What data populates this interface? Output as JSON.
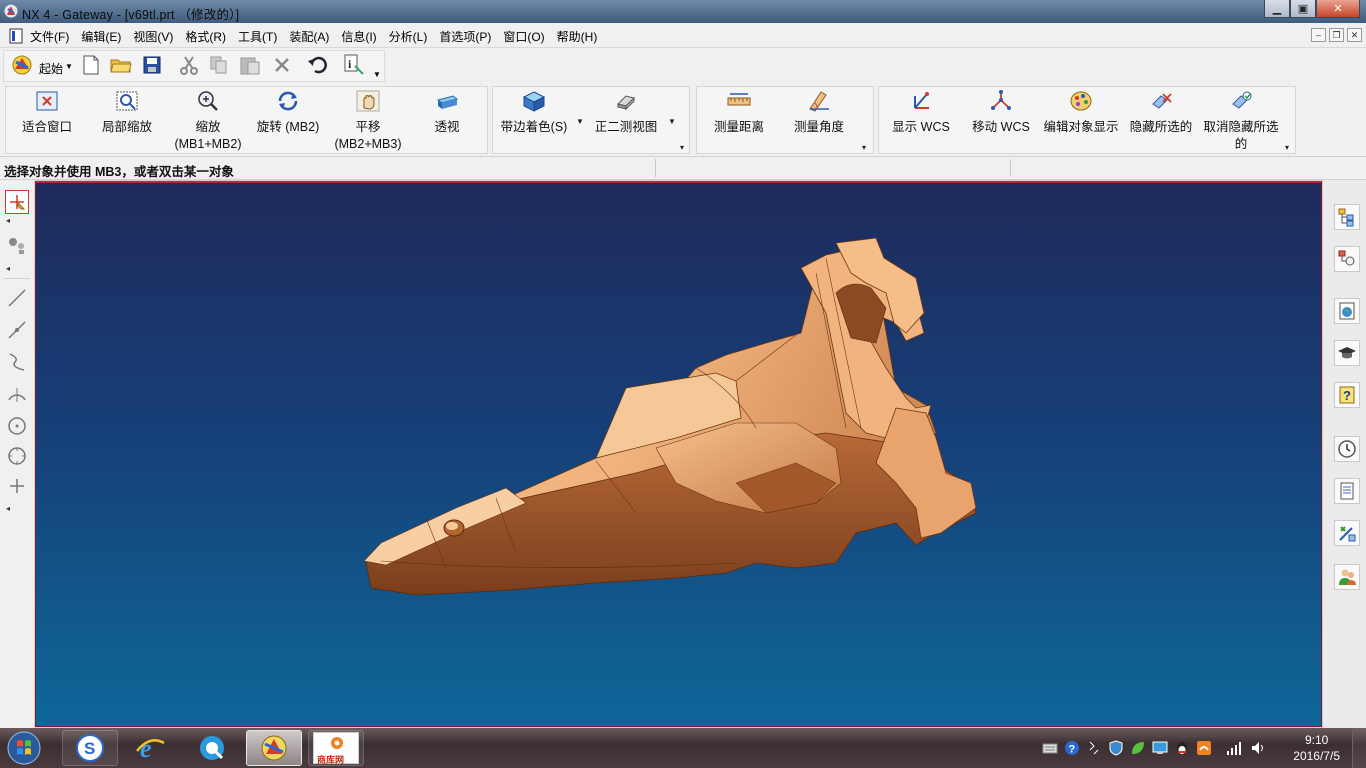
{
  "window": {
    "title": "NX 4 - Gateway - [v69tl.prt （修改的）]",
    "controls": [
      "minimize",
      "maximize",
      "close"
    ]
  },
  "menubar": {
    "items": [
      "文件(F)",
      "编辑(E)",
      "视图(V)",
      "格式(R)",
      "工具(T)",
      "装配(A)",
      "信息(I)",
      "分析(L)",
      "首选项(P)",
      "窗口(O)",
      "帮助(H)"
    ]
  },
  "standard_toolbar": {
    "start_label": "起始",
    "icons": [
      "new-icon",
      "open-icon",
      "save-icon",
      "cut-icon",
      "copy-icon",
      "paste-icon",
      "delete-icon",
      "undo-icon",
      "info-icon"
    ]
  },
  "view_toolbar": {
    "buttons": [
      {
        "label": "适合窗口",
        "icon": "fit-icon"
      },
      {
        "label": "局部缩放",
        "icon": "zoom-region-icon"
      },
      {
        "label": "缩放",
        "label2": "(MB1+MB2)",
        "icon": "zoom-icon"
      },
      {
        "label": "旋转 (MB2)",
        "icon": "rotate-icon"
      },
      {
        "label": "平移",
        "label2": "(MB2+MB3)",
        "icon": "pan-icon"
      },
      {
        "label": "透视",
        "icon": "perspective-icon"
      },
      {
        "label": "带边着色(S)",
        "icon": "shaded-edges-icon"
      },
      {
        "label": "正二测视图",
        "icon": "dimetric-icon"
      }
    ]
  },
  "analysis_toolbar": {
    "buttons": [
      {
        "label": "测量距离",
        "icon": "measure-distance-icon"
      },
      {
        "label": "测量角度",
        "icon": "measure-angle-icon"
      }
    ]
  },
  "utility_toolbar": {
    "buttons": [
      {
        "label": "显示 WCS",
        "icon": "show-wcs-icon"
      },
      {
        "label": "移动 WCS",
        "icon": "move-wcs-icon"
      },
      {
        "label": "编辑对象显示",
        "icon": "edit-display-icon"
      },
      {
        "label": "隐藏所选的",
        "icon": "hide-icon"
      },
      {
        "label": "取消隐藏所选",
        "label2": "的",
        "icon": "unhide-icon"
      }
    ]
  },
  "status": {
    "message": "选择对象并使用 MB3，或者双击某一对象"
  },
  "resource_bar": {
    "icons": [
      "assembly-navigator-icon",
      "part-navigator-icon",
      "web-browser-icon",
      "training-icon",
      "help-icon",
      "history-icon",
      "system-materials-icon",
      "roles-edit-icon",
      "roles-icon"
    ]
  },
  "taskbar": {
    "apps": [
      "start-orb",
      "sogou-icon",
      "ie-icon",
      "browser-icon",
      "nx-icon",
      "shangku-icon"
    ],
    "shangku_label": "商库网",
    "time": "9:10",
    "date": "2016/7/5"
  },
  "colors": {
    "viewport_top": "#1f2a5c",
    "viewport_bottom": "#0e6799",
    "model": "#f2b07a",
    "active_border": "#b02a3a"
  }
}
